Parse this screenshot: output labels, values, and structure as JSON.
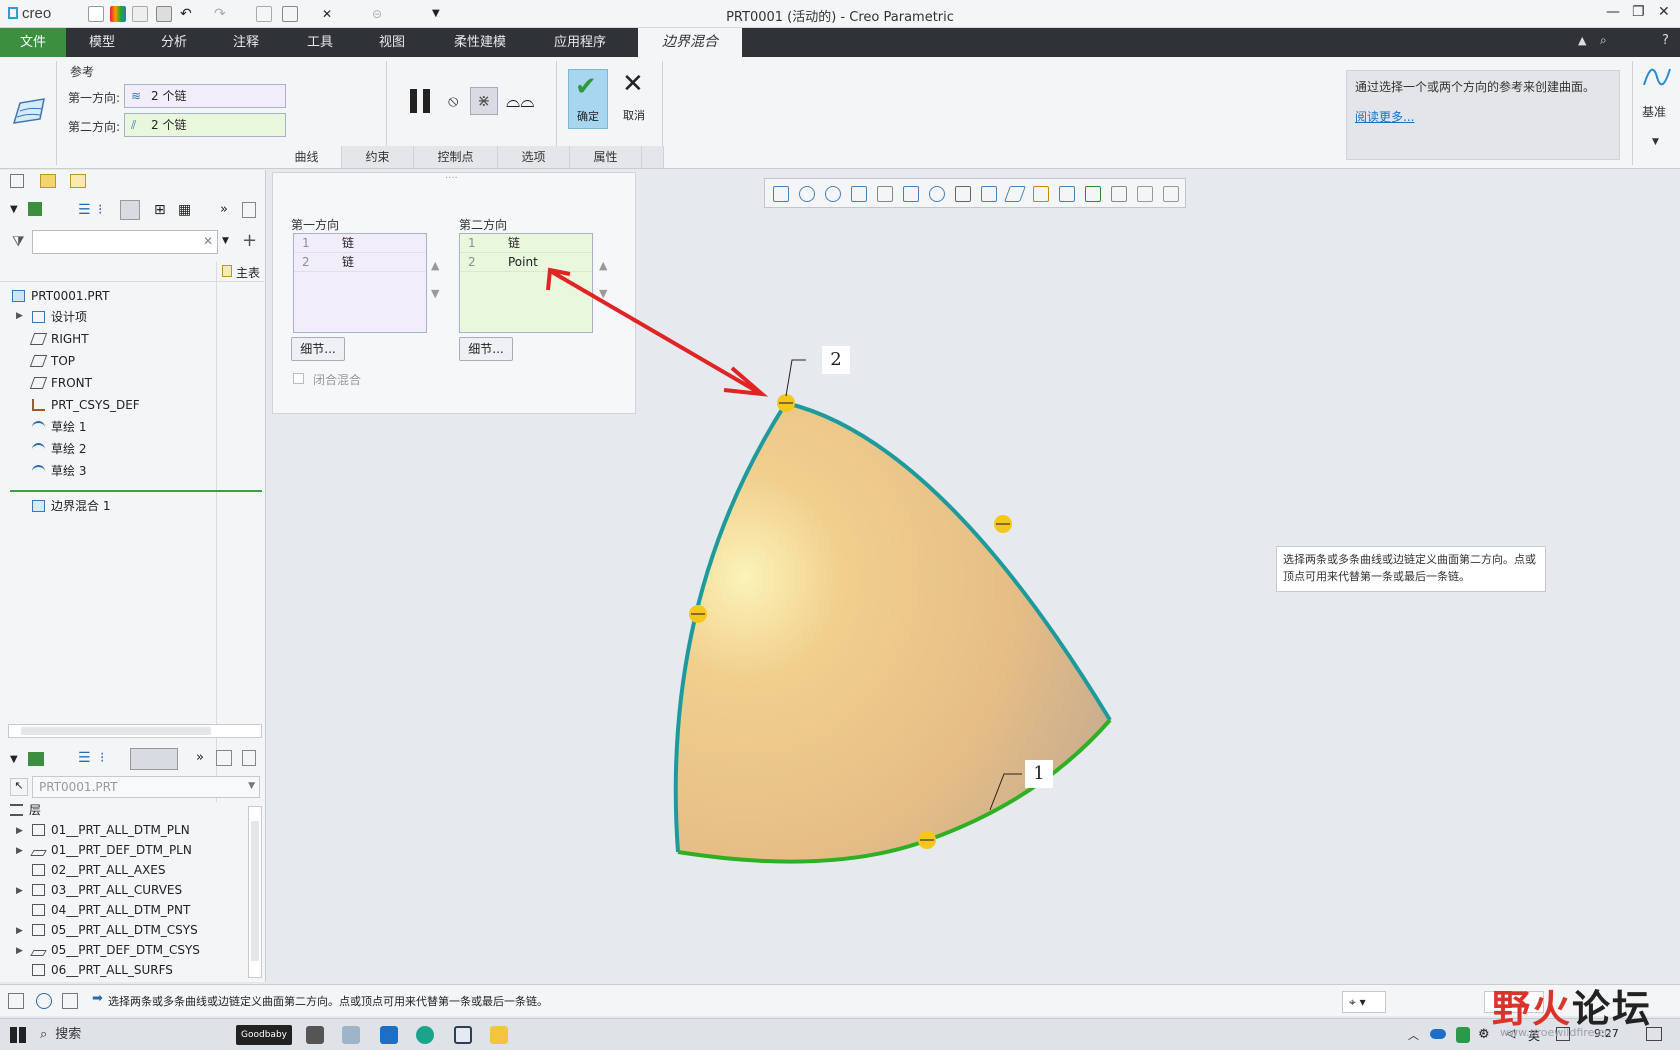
{
  "app": {
    "logo": "creo",
    "window_title": "PRT0001 (活动的) - Creo Parametric",
    "accent": "#3b8f3f"
  },
  "tabs": [
    "文件",
    "模型",
    "分析",
    "注释",
    "工具",
    "视图",
    "柔性建模",
    "应用程序",
    "边界混合"
  ],
  "references": {
    "group_label": "参考",
    "dir1_label": "第一方向:",
    "dir1_value": "2 个链",
    "dir2_label": "第二方向:",
    "dir2_value": "2 个链"
  },
  "actions": {
    "ok": "确定",
    "cancel": "取消",
    "datum": "基准"
  },
  "subtabs": [
    "曲线",
    "约束",
    "控制点",
    "选项",
    "属性"
  ],
  "info": {
    "text": "通过选择一个或两个方向的参考来创建曲面。",
    "link": "阅读更多..."
  },
  "model_tree": {
    "header_right": "主表",
    "root": "PRT0001.PRT",
    "items": [
      "设计项",
      "RIGHT",
      "TOP",
      "FRONT",
      "PRT_CSYS_DEF",
      "草绘 1",
      "草绘 2",
      "草绘 3",
      "边界混合 1"
    ]
  },
  "layers": {
    "selector": "PRT0001.PRT",
    "header": "层",
    "items": [
      "01__PRT_ALL_DTM_PLN",
      "01__PRT_DEF_DTM_PLN",
      "02__PRT_ALL_AXES",
      "03__PRT_ALL_CURVES",
      "04__PRT_ALL_DTM_PNT",
      "05__PRT_ALL_DTM_CSYS",
      "05__PRT_DEF_DTM_CSYS",
      "06__PRT_ALL_SURFS"
    ]
  },
  "curves_panel": {
    "dir1_title": "第一方向",
    "dir1_rows": [
      {
        "n": "1",
        "t": "链"
      },
      {
        "n": "2",
        "t": "链"
      }
    ],
    "dir2_title": "第二方向",
    "dir2_rows": [
      {
        "n": "1",
        "t": "链"
      },
      {
        "n": "2",
        "t": "Point"
      }
    ],
    "details": "细节...",
    "closed_blend": "闭合混合"
  },
  "viewport": {
    "label_1": "1",
    "label_2": "2",
    "tooltip": "选择两条或多条曲线或边链定义曲面第二方向。点或顶点可用来代替第一条或最后一条链。"
  },
  "status": {
    "message": "选择两条或多条曲线或边链定义曲面第二方向。点或顶点可用来代替第一条或最后一条链。"
  },
  "taskbar": {
    "search": "搜索",
    "goodbaby": "Goodbaby",
    "lang": "英",
    "time": "9:27"
  },
  "watermark": {
    "text_red": "野火",
    "text_dark": "论坛",
    "url": "www.proewildfire.cn"
  }
}
